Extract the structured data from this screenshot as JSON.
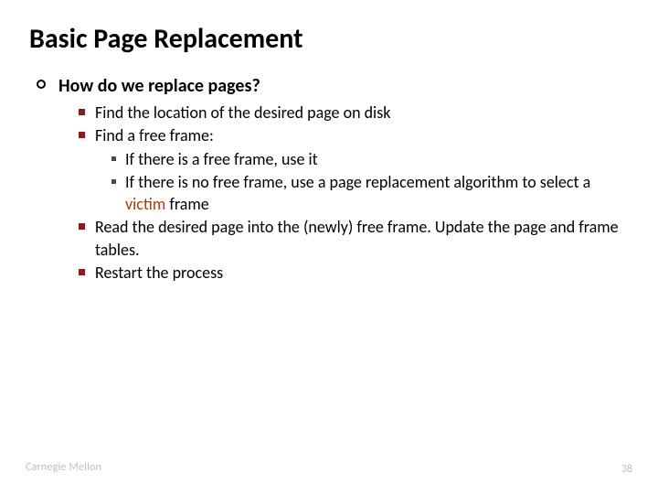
{
  "title": "Basic Page Replacement",
  "q": "How do we replace pages?",
  "b1": "Find the location of the desired page on disk",
  "b2": "Find a free frame:",
  "b2a": "If there is a free frame, use it",
  "b2b_pre": "If there is no free frame, use a page replacement algorithm to select a ",
  "b2b_victim": "victim",
  "b2b_post": " frame",
  "b3": "Read the desired page into the (newly) free frame. Update the page and frame tables.",
  "b4": "Restart the process",
  "institution": "Carnegie Mellon",
  "pagenum": "38"
}
